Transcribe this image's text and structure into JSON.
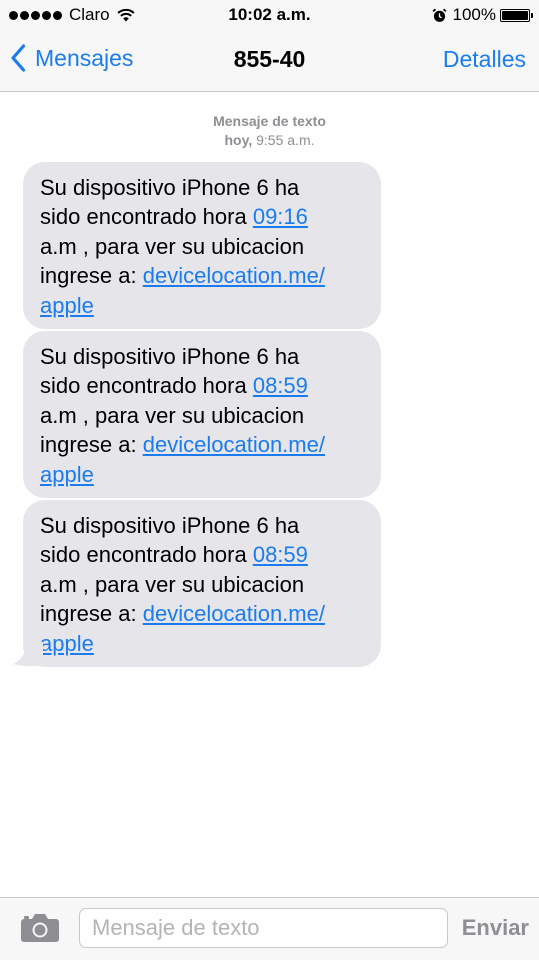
{
  "status_bar": {
    "carrier": "Claro",
    "time": "10:02 a.m.",
    "battery": "100%",
    "signal_icon": "signal-dots-icon",
    "wifi_icon": "wifi-icon",
    "alarm_icon": "alarm-clock-icon",
    "battery_icon": "battery-icon",
    "battery_level": 1.0
  },
  "nav_bar": {
    "back_label": "Mensajes",
    "back_icon": "chevron-left-icon",
    "title": "855-40",
    "details_label": "Detalles",
    "accent_color": "#1a7cf0"
  },
  "conversation": {
    "header_type": "Mensaje de texto",
    "header_day": "hoy,",
    "header_time": "9:55 a.m.",
    "bubble_color": "#e5e5ea",
    "messages": [
      {
        "line1": "Su dispositivo iPhone 6 ha",
        "line2_prefix": "sido encontrado hora",
        "time_link": "09:16",
        "line3": "a.m , para ver su ubicacion",
        "line4_prefix": "ingrese a:",
        "url_part1": "devicelocation.me/",
        "url_part2": "apple"
      },
      {
        "line1": "Su dispositivo iPhone 6 ha",
        "line2_prefix": "sido encontrado hora",
        "time_link": "08:59",
        "line3": "a.m , para ver su ubicacion",
        "line4_prefix": "ingrese a:",
        "url_part1": "devicelocation.me/",
        "url_part2": "apple"
      },
      {
        "line1": "Su dispositivo iPhone 6 ha",
        "line2_prefix": "sido encontrado hora",
        "time_link": "08:59",
        "line3": "a.m , para ver su ubicacion",
        "line4_prefix": "ingrese a:",
        "url_part1": "devicelocation.me/",
        "url_part2": "apple"
      }
    ]
  },
  "input_bar": {
    "camera_icon": "camera-icon",
    "placeholder": "Mensaje de texto",
    "value": "",
    "send_label": "Enviar"
  }
}
